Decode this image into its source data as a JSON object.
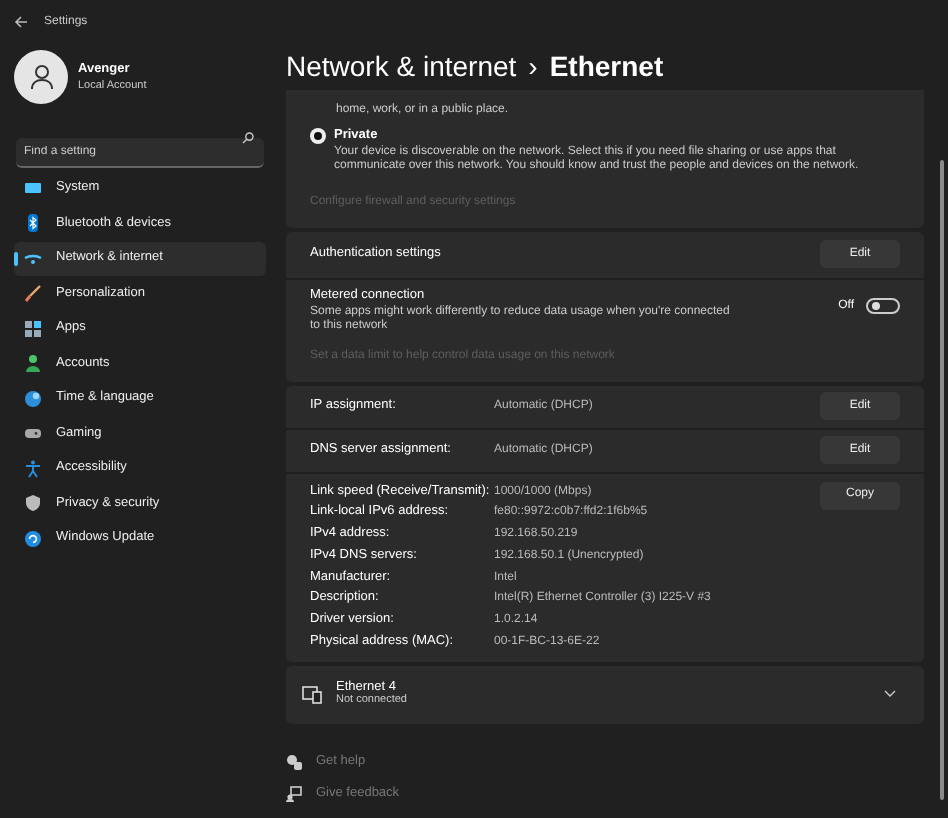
{
  "window": {
    "title": "Settings"
  },
  "account": {
    "name": "Avenger",
    "type": "Local Account"
  },
  "search": {
    "placeholder": "Find a setting"
  },
  "nav": [
    {
      "label": "System",
      "kind": "system",
      "selected": false
    },
    {
      "label": "Bluetooth & devices",
      "kind": "bluetooth",
      "selected": false
    },
    {
      "label": "Network & internet",
      "kind": "network",
      "selected": true
    },
    {
      "label": "Personalization",
      "kind": "brush",
      "selected": false
    },
    {
      "label": "Apps",
      "kind": "apps",
      "selected": false
    },
    {
      "label": "Accounts",
      "kind": "person",
      "selected": false
    },
    {
      "label": "Time & language",
      "kind": "globe",
      "selected": false
    },
    {
      "label": "Gaming",
      "kind": "gamepad",
      "selected": false
    },
    {
      "label": "Accessibility",
      "kind": "accessibility",
      "selected": false
    },
    {
      "label": "Privacy & security",
      "kind": "shield",
      "selected": false
    },
    {
      "label": "Windows Update",
      "kind": "update",
      "selected": false
    }
  ],
  "breadcrumb": {
    "parent": "Network & internet",
    "separator": "›",
    "current": "Ethernet"
  },
  "network_profile": {
    "partial_text": "home, work, or in a public place.",
    "options": [
      {
        "label": "Private",
        "selected": true,
        "description": "Your device is discoverable on the network. Select this if you need file sharing or use apps that communicate over this network. You should know and trust the people and devices on the network."
      }
    ],
    "link": {
      "label": "Configure firewall and security settings",
      "disabled": true
    }
  },
  "authentication": {
    "label": "Authentication settings",
    "button": "Edit"
  },
  "metered": {
    "title": "Metered connection",
    "description": "Some apps might work differently to reduce data usage when you're connected to this network",
    "state_label": "Off",
    "on": false,
    "link": {
      "label": "Set a data limit to help control data usage on this network",
      "disabled": true
    }
  },
  "assignments": [
    {
      "label": "IP assignment:",
      "value": "Automatic (DHCP)",
      "button": "Edit"
    },
    {
      "label": "DNS server assignment:",
      "value": "Automatic (DHCP)",
      "button": "Edit"
    }
  ],
  "properties": [
    {
      "label": "Link speed (Receive/Transmit):",
      "value": "1000/1000 (Mbps)"
    },
    {
      "label": "Link-local IPv6 address:",
      "value": "fe80::9972:c0b7:ffd2:1f6b%5"
    },
    {
      "label": "IPv4 address:",
      "value": "192.168.50.219"
    },
    {
      "label": "IPv4 DNS servers:",
      "value": "192.168.50.1 (Unencrypted)"
    },
    {
      "label": "Manufacturer:",
      "value": "Intel"
    },
    {
      "label": "Description:",
      "value": "Intel(R) Ethernet Controller (3) I225-V #3"
    },
    {
      "label": "Driver version:",
      "value": "1.0.2.14"
    },
    {
      "label": "Physical address (MAC):",
      "value": "00-1F-BC-13-6E-22"
    }
  ],
  "copy_button": "Copy",
  "adapter": {
    "name": "Ethernet 4",
    "status": "Not connected",
    "expanded": false
  },
  "footer_links": [
    {
      "label": "Get help",
      "kind": "help"
    },
    {
      "label": "Give feedback",
      "kind": "feedback"
    }
  ]
}
